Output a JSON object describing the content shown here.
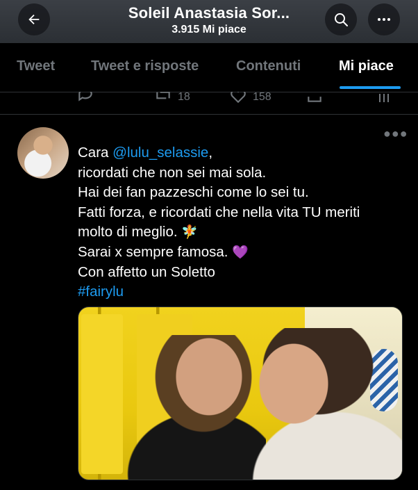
{
  "header": {
    "title": "Soleil Anastasia Sor...",
    "subtitle": "3.915 Mi piace",
    "back_icon": "arrow-left-icon",
    "search_icon": "search-icon",
    "more_icon": "more-horizontal-icon"
  },
  "tabs": [
    {
      "label": "Tweet"
    },
    {
      "label": "Tweet e risposte"
    },
    {
      "label": "Contenuti"
    },
    {
      "label": "Mi piace",
      "active": true
    }
  ],
  "prev_tweet_actions": {
    "retweets": "18",
    "likes": "158"
  },
  "tweet": {
    "lines": [
      {
        "pre": "Cara ",
        "link": "@lulu_selassie",
        "post": ","
      },
      {
        "text": "ricordati che non sei mai sola."
      },
      {
        "text": "Hai dei fan pazzeschi come lo sei tu."
      },
      {
        "text": "Fatti forza, e ricordati che nella vita TU meriti"
      },
      {
        "text": "molto di meglio.",
        "emoji": "🧚"
      },
      {
        "text": "Sarai x sempre famosa.",
        "emoji": "💜"
      },
      {
        "text": "Con affetto un Soletto"
      },
      {
        "hashtag": "#fairylu"
      }
    ]
  },
  "colors": {
    "accent": "#1d9bf0",
    "background": "#000000",
    "muted": "#71767b",
    "heart_purple": "#a259f7"
  }
}
